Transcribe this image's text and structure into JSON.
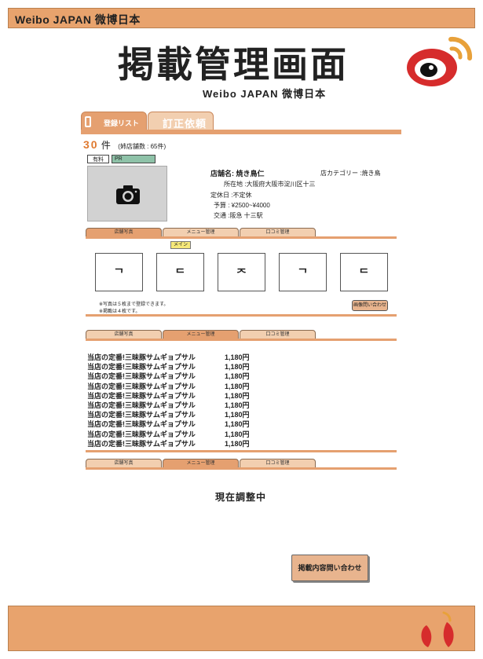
{
  "header": {
    "brand": "Weibo JAPAN 微博日本"
  },
  "page": {
    "title": "掲載管理画面",
    "subtitle": "Weibo JAPAN 微博日本"
  },
  "tabs": {
    "list_label": "登録リスト",
    "fix_label": "訂正依頼"
  },
  "summary": {
    "count": "30",
    "unit": "件",
    "branch": "(姉店舗数 : 65件)"
  },
  "badges": {
    "paid": "有料",
    "pr": "PR"
  },
  "store": {
    "name_label": "店舗名:",
    "name": "焼き鳥仁",
    "category": "店カテゴリー :焼き鳥",
    "address": "所在地  :大阪府大阪市淀川区十三",
    "holiday": "定休日  :不定休",
    "budget": "予算   : ¥2500~¥4000",
    "access": "交通   :阪急  十三駅"
  },
  "section_tabs": [
    "店舗写真",
    "メニュー管理",
    "口コミ管理"
  ],
  "photos": {
    "main_tag": "メイン",
    "glyphs": [
      "ᄀ",
      "ᄃ",
      "ᄌ",
      "ᄀ",
      "ᄃ"
    ],
    "note1": "※写真は５枚まで登録できます。",
    "note2": "※掲載は４枚です。",
    "inquire_small": "画像問い合わせ"
  },
  "menu_items": [
    {
      "name": "当店の定番!三昧豚サムギョプサル",
      "price": "1,180円"
    },
    {
      "name": "当店の定番!三昧豚サムギョプサル",
      "price": "1,180円"
    },
    {
      "name": "当店の定番!三昧豚サムギョプサル",
      "price": "1,180円"
    },
    {
      "name": "当店の定番!三昧豚サムギョプサル",
      "price": "1,180円"
    },
    {
      "name": "当店の定番!三昧豚サムギョプサル",
      "price": "1,180円"
    },
    {
      "name": "当店の定番!三昧豚サムギョプサル",
      "price": "1,180円"
    },
    {
      "name": "当店の定番!三昧豚サムギョプサル",
      "price": "1,180円"
    },
    {
      "name": "当店の定番!三昧豚サムギョプサル",
      "price": "1,180円"
    },
    {
      "name": "当店の定番!三昧豚サムギョプサル",
      "price": "1,180円"
    },
    {
      "name": "当店の定番!三昧豚サムギョプサル",
      "price": "1,180円"
    }
  ],
  "reviews": {
    "status": "現在調整中"
  },
  "actions": {
    "inquire": "掲載内容問い合わせ"
  },
  "colors": {
    "accent": "#E8A36D",
    "tab": "#E5A070",
    "tab_light": "#F2CFB0",
    "pr": "#8EC2A8",
    "logo_red": "#D62C2C"
  }
}
